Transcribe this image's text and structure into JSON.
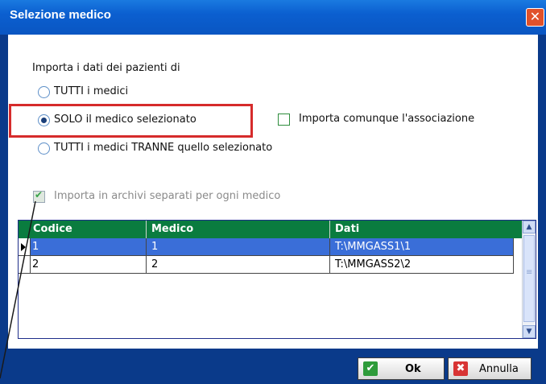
{
  "window": {
    "title": "Selezione medico",
    "close_symbol": "✕"
  },
  "options": {
    "heading": "Importa i dati dei pazienti di",
    "radio_all": "TUTTI i medici",
    "radio_selected": "SOLO il medico selezionato",
    "radio_except": "TUTTI i medici TRANNE quello selezionato",
    "checkbox_association": "Importa comunque l'associazione",
    "checkbox_separate": "Importa in archivi separati per ogni medico",
    "selected_option": "radio_selected"
  },
  "table": {
    "columns": [
      "Codice",
      "Medico",
      "Dati"
    ],
    "rows": [
      {
        "codice": "1",
        "medico": "1",
        "dati": "T:\\MMGASS1\\1",
        "selected": true
      },
      {
        "codice": "2",
        "medico": "2",
        "dati": "T:\\MMGASS2\\2",
        "selected": false
      }
    ]
  },
  "buttons": {
    "ok": "Ok",
    "cancel": "Annulla"
  },
  "colors": {
    "title_bar": "#0b5fd0",
    "grid_header": "#0a7c3f",
    "selection": "#3a6ed8",
    "highlight_box": "#d62b2b"
  }
}
